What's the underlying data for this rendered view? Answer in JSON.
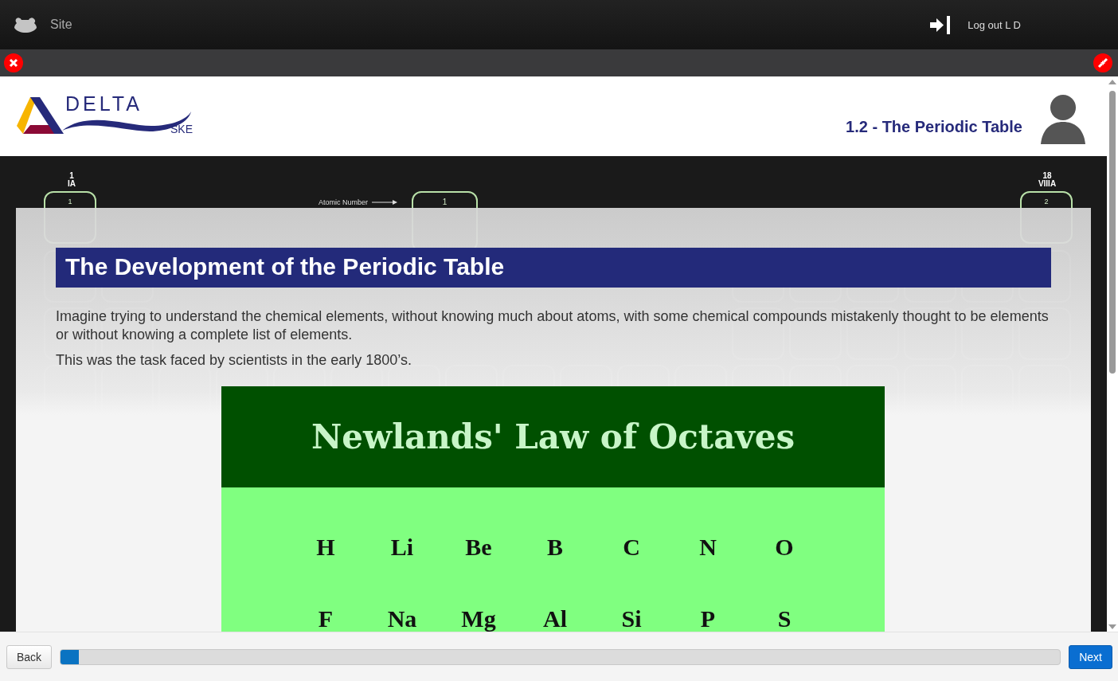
{
  "top_bar": {
    "site_label": "Site",
    "logout_label": "Log out L D"
  },
  "course_header": {
    "logo_word": "DELTA",
    "logo_sub": "SKE",
    "title": "1.2 - The Periodic Table"
  },
  "background_table": {
    "groups": [
      {
        "number": "1",
        "name": "IA"
      },
      {
        "number": "18",
        "name": "VIIIA"
      }
    ],
    "tiles": [
      {
        "number": "1"
      },
      {
        "number": "2"
      }
    ],
    "key": {
      "number": "1",
      "atomic_number_label": "Atomic Number"
    }
  },
  "lesson": {
    "heading": "The Development of the Periodic Table",
    "paragraphs": [
      "Imagine trying to understand the chemical elements, without knowing much about atoms, with some chemical compounds mistakenly thought to be elements or without knowing a complete list of elements.",
      "This was the task faced by scientists in the early 1800’s."
    ],
    "figure": {
      "title": "Newlands' Law of Octaves",
      "rows": [
        [
          "H",
          "Li",
          "Be",
          "B",
          "C",
          "N",
          "O"
        ],
        [
          "F",
          "Na",
          "Mg",
          "Al",
          "Si",
          "P",
          "S"
        ]
      ]
    }
  },
  "footer": {
    "back_label": "Back",
    "progress": {
      "level": 0.018
    },
    "next_label": "Next"
  }
}
